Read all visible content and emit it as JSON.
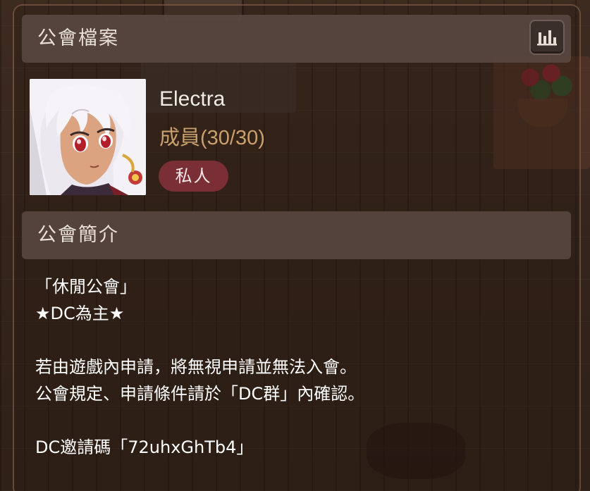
{
  "profile_section": {
    "title": "公會檔案"
  },
  "guild": {
    "name": "Electra",
    "members_label": "成員",
    "members_count": "(30/30)",
    "privacy": "私人"
  },
  "intro_section": {
    "title": "公會簡介",
    "lines": [
      "「休閒公會」",
      "★DC為主★",
      "",
      "若由遊戲內申請，將無視申請並無法入會。",
      "公會規定、申請條件請於「DC群」內確認。",
      "",
      "DC邀請碼「72uhxGhTb4」"
    ]
  },
  "icons": {
    "stats": "bar-chart-icon",
    "avatar": "guild-avatar-image"
  },
  "colors": {
    "section_bar": "#584640",
    "members_text": "#c9a06e",
    "badge_bg": "#7a2e36"
  }
}
